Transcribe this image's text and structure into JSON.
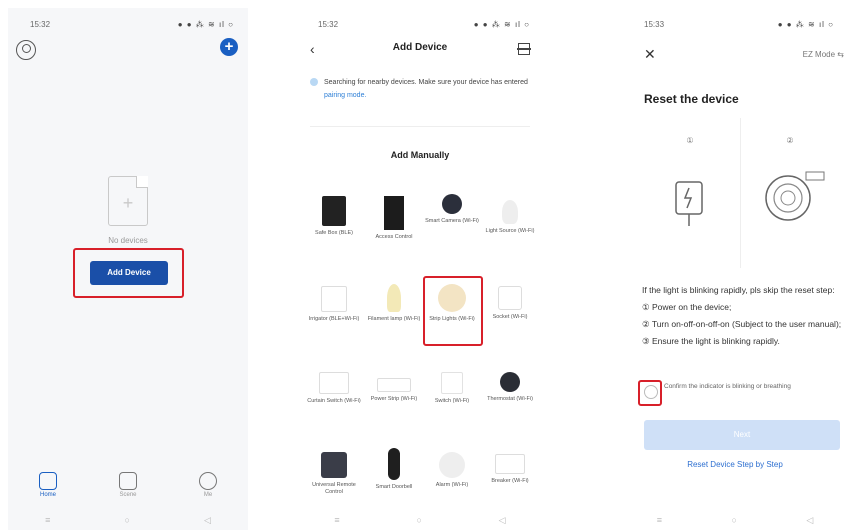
{
  "screen1": {
    "status_time": "15:32",
    "status_icons": "● ● ⁂ ≋ ıl ○",
    "empty_text": "No devices",
    "add_button": "Add Device",
    "tabs": [
      {
        "label": "Home"
      },
      {
        "label": "Scene"
      },
      {
        "label": "Me"
      }
    ]
  },
  "screen2": {
    "status_time": "15:32",
    "status_icons": "● ● ⁂ ≋ ıl ○",
    "back_glyph": "‹",
    "title": "Add Device",
    "searching_text": "Searching for nearby devices. Make sure your device has entered",
    "searching_link": "pairing mode.",
    "section_title": "Add Manually",
    "devices": [
      {
        "label": "Safe Box (BLE)"
      },
      {
        "label": "Access Control"
      },
      {
        "label": "Smart Camera (Wi-Fi)"
      },
      {
        "label": "Light Source (Wi-Fi)"
      },
      {
        "label": "Irrigator (BLE+Wi-Fi)"
      },
      {
        "label": "Filament lamp (Wi-Fi)"
      },
      {
        "label": "Strip Lights (Wi-Fi)"
      },
      {
        "label": "Socket (Wi-Fi)"
      },
      {
        "label": "Curtain Switch (Wi-Fi)"
      },
      {
        "label": "Power Strip (Wi-Fi)"
      },
      {
        "label": "Switch (Wi-Fi)"
      },
      {
        "label": "Thermostat (Wi-Fi)"
      },
      {
        "label": "Universal Remote Control"
      },
      {
        "label": "Smart Doorbell"
      },
      {
        "label": "Alarm (Wi-Fi)"
      },
      {
        "label": "Breaker (Wi-Fi)"
      }
    ]
  },
  "screen3": {
    "status_time": "15:33",
    "status_icons": "● ● ⁂ ≋ ıl ○",
    "close_glyph": "✕",
    "mode": "EZ Mode ⇆",
    "title": "Reset the device",
    "pane1_num": "①",
    "pane2_num": "②",
    "instructions": [
      "If the light is blinking rapidly, pls skip the reset step:",
      "① Power on the device;",
      "② Turn on-off-on-off-on (Subject to the user manual);",
      "③ Ensure the light is blinking rapidly."
    ],
    "confirm_text": "Confirm the indicator is blinking or breathing",
    "next_button": "Next",
    "step_link": "Reset Device Step by Step"
  },
  "nav": {
    "menu": "≡",
    "home": "○",
    "back": "◁"
  }
}
